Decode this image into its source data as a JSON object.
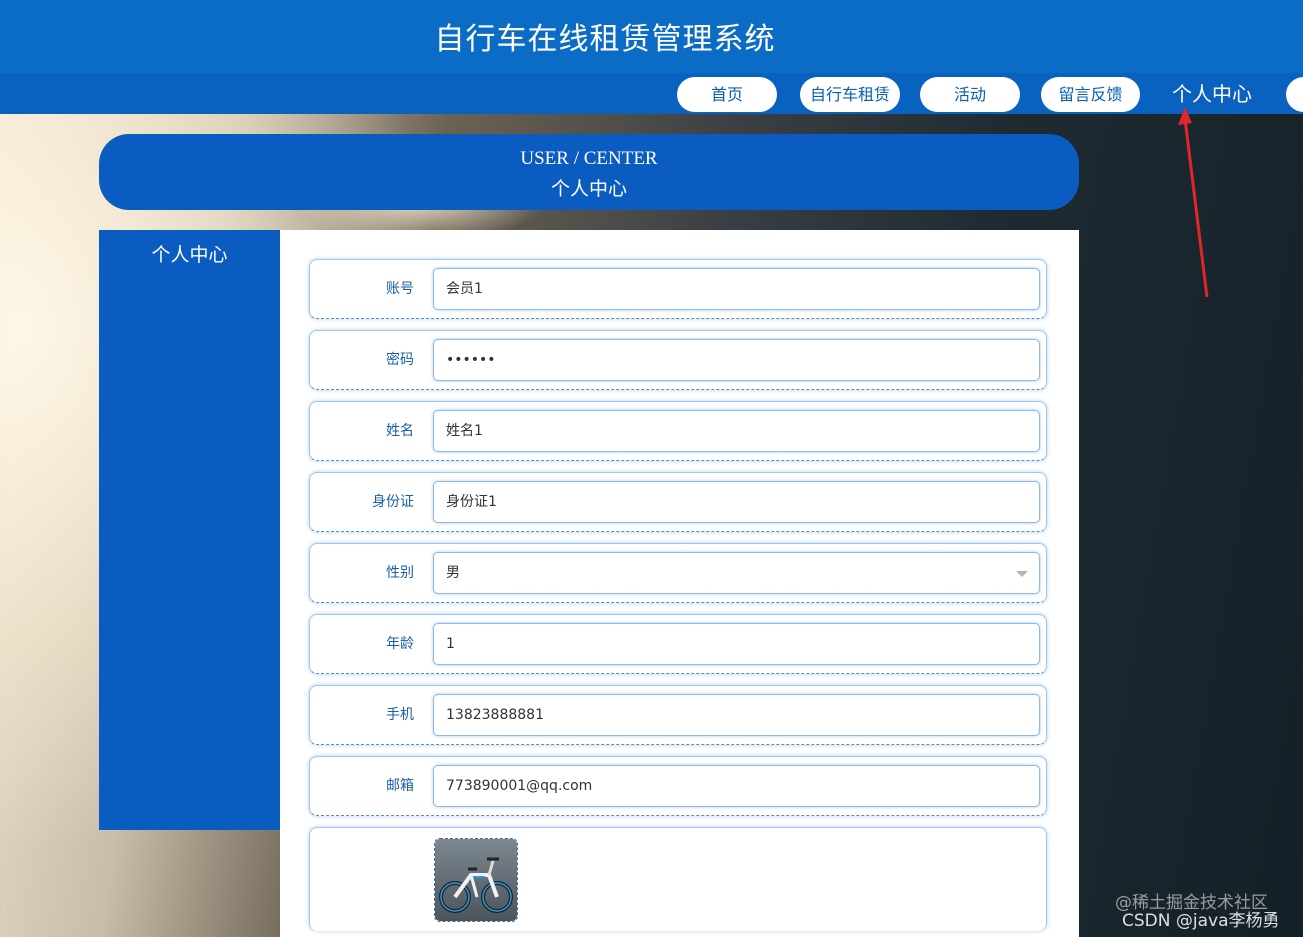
{
  "header": {
    "title": "自行车在线租赁管理系统"
  },
  "nav": {
    "items": [
      "首页",
      "自行车租赁",
      "活动",
      "留言反馈"
    ],
    "active": "个人中心"
  },
  "banner": {
    "en": "USER / CENTER",
    "cn": "个人中心"
  },
  "sidebar": {
    "items": [
      "个人中心"
    ]
  },
  "form": {
    "fields": [
      {
        "label": "账号",
        "value": "会员1"
      },
      {
        "label": "密码",
        "value": "••••••"
      },
      {
        "label": "姓名",
        "value": "姓名1"
      },
      {
        "label": "身份证",
        "value": "身份证1"
      },
      {
        "label": "性别",
        "value": "男"
      },
      {
        "label": "年龄",
        "value": "1"
      },
      {
        "label": "手机",
        "value": "13823888881"
      },
      {
        "label": "邮箱",
        "value": "773890001@qq.com"
      }
    ]
  },
  "watermark": {
    "line1": "@稀土掘金技术社区",
    "line2": "CSDN @java李杨勇"
  },
  "colors": {
    "primary": "#0a6cc4",
    "panel_blue": "#0a5cc0",
    "arrow": "#e0262a"
  }
}
